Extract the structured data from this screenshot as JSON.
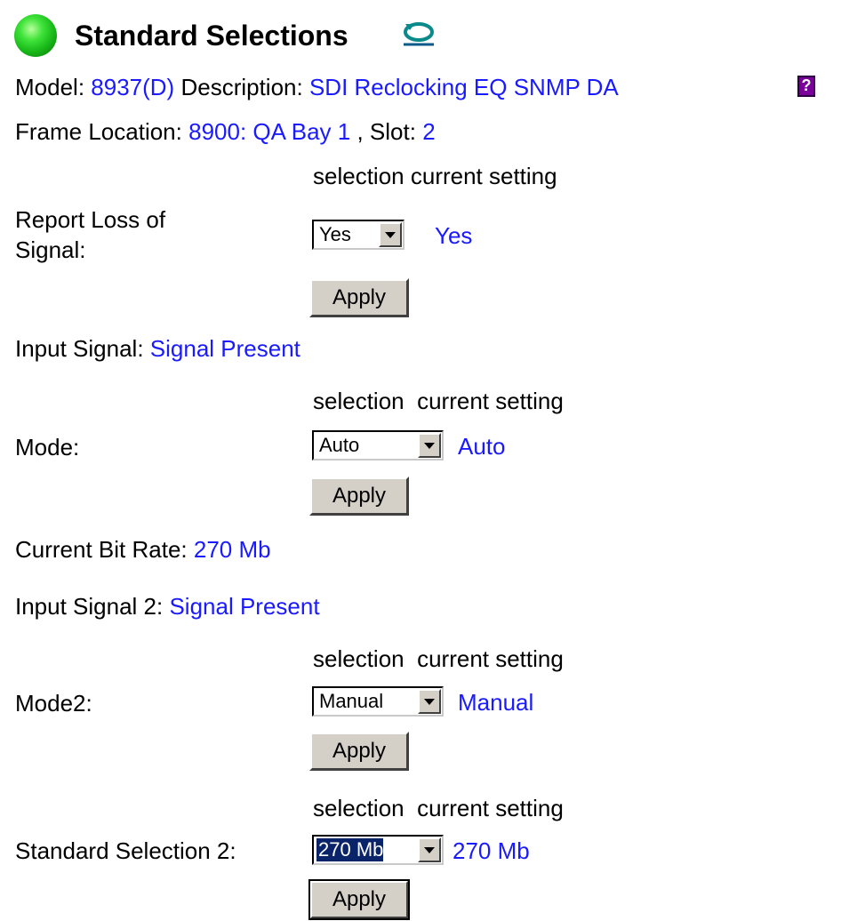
{
  "header": {
    "title": "Standard Selections"
  },
  "info": {
    "model_label": "Model:",
    "model_value": "8937(D)",
    "description_label": "Description:",
    "description_value": "SDI Reclocking EQ SNMP DA",
    "frame_label": "Frame Location:",
    "frame_value": "8900: QA Bay 1",
    "slot_label": ", Slot:",
    "slot_value": "2"
  },
  "col_headers": {
    "selection": "selection",
    "current_setting": "current setting"
  },
  "report_loss": {
    "label_line1": "Report Loss of",
    "label_line2": "Signal:",
    "selected": "Yes",
    "current": "Yes",
    "apply": "Apply"
  },
  "input_signal": {
    "label": "Input Signal:",
    "value": "Signal Present"
  },
  "mode": {
    "label": "Mode:",
    "selected": "Auto",
    "current": "Auto",
    "apply": "Apply"
  },
  "bit_rate": {
    "label": "Current Bit Rate:",
    "value": "270 Mb"
  },
  "input_signal_2": {
    "label": "Input Signal 2:",
    "value": "Signal Present"
  },
  "mode2": {
    "label": "Mode2:",
    "selected": "Manual",
    "current": "Manual",
    "apply": "Apply"
  },
  "std_sel_2": {
    "label": "Standard Selection 2:",
    "selected": "270 Mb",
    "current": "270 Mb",
    "apply": "Apply"
  },
  "colors": {
    "value_blue": "#1a1aff",
    "led_green": "#2ecf2a",
    "button_face": "#d4d0c8",
    "select_highlight": "#0a246a"
  },
  "icons": {
    "status": "green-led-icon",
    "refresh": "refresh-icon",
    "help": "help-icon"
  }
}
